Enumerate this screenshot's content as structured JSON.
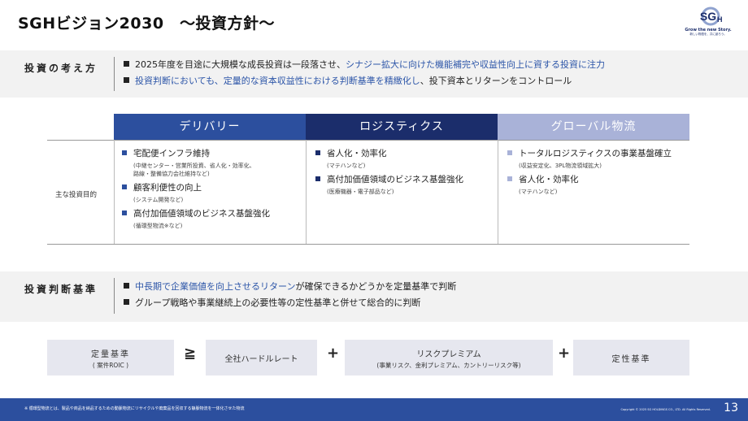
{
  "title": "SGHビジョン2030　～投資方針～",
  "logo": {
    "mark": "SGH",
    "tagline": "Grow the new Story.",
    "subtagline": "新しい物語を、共に創ろう。"
  },
  "policy": {
    "label": "投資の考え方",
    "bullets": [
      {
        "pre": "2025年度を目途に大規模な成長投資は一段落させ、",
        "hl": "シナジー拡大に向けた機能補完や収益性向上に資する投資に注力",
        "post": ""
      },
      {
        "pre": "",
        "hl": "投資判断においても、定量的な資本収益性における判断基準を精緻化し",
        "post": "、投下資本とリターンをコントロール"
      }
    ]
  },
  "table": {
    "headers": [
      "デリバリー",
      "ロジスティクス",
      "グローバル物流"
    ],
    "row_label": "主な投資目的",
    "columns": [
      [
        {
          "item": "宅配便インフラ維持",
          "sub": [
            "(中継センター・営業所投資、省人化・効率化、",
            "路線・整備協力会社維持など)"
          ]
        },
        {
          "item": "顧客利便性の向上",
          "sub": [
            "(システム開発など)"
          ]
        },
        {
          "item": "高付加価値領域のビジネス基盤強化",
          "sub": [
            "(循環型物流※など)"
          ]
        }
      ],
      [
        {
          "item": "省人化・効率化",
          "sub": [
            "(マテハンなど)"
          ]
        },
        {
          "item": "高付加価値領域のビジネス基盤強化",
          "sub": [
            "(医療機器・電子部品など)"
          ]
        }
      ],
      [
        {
          "item": "トータルロジスティクスの事業基盤確立",
          "sub": [
            "(収益安定化、3PL物流領域拡大)"
          ]
        },
        {
          "item": "省人化・効率化",
          "sub": [
            "(マテハンなど)"
          ]
        }
      ]
    ]
  },
  "criteria": {
    "label": "投資判断基準",
    "bullets": [
      {
        "pre": "",
        "hl": "中長期で企業価値を向上させるリターン",
        "post": "が確保できるかどうかを定量基準で判断"
      },
      {
        "pre": "グループ戦略や事業継続上の必要性等の定性基準と併せて総合的に判断",
        "hl": "",
        "post": ""
      }
    ]
  },
  "formula": {
    "box1": {
      "main": "定量基準",
      "sub": "( 案件ROIC )"
    },
    "op1": "≧",
    "box2": {
      "main": "全社ハードルレート"
    },
    "op2": "+",
    "box3": {
      "main": "リスクプレミアム",
      "sub": "(事業リスク、金利プレミアム、カントリーリスク等)"
    },
    "op3": "+",
    "box4": {
      "main": "定性基準"
    }
  },
  "footer": {
    "footnote": "※ 循環型物流とは、製品や商品を納品するための動脈物流にリサイクルや廃棄品を回収する静脈物流を一体化させた物流",
    "copyright": "Copyright © 2025 SG HOLDINGS CO., LTD. All Rights Reserved.",
    "page": "13"
  }
}
